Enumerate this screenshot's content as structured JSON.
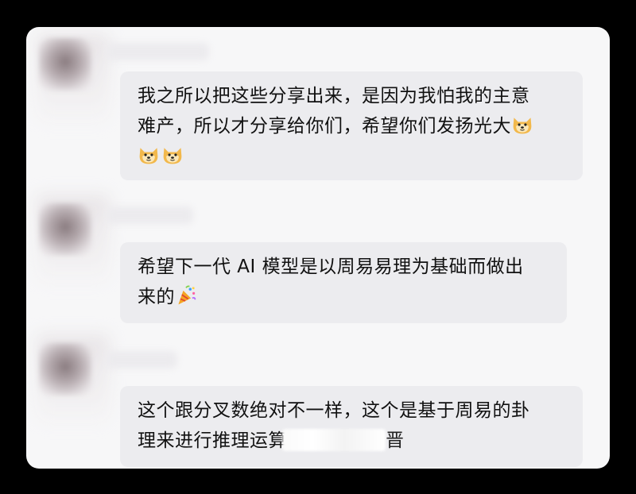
{
  "messages": [
    {
      "lines": [
        "我之所以把这些分享出来，是因为我怕我的主意",
        "难产，所以才分享给你们，希望你们发扬光大"
      ],
      "emojis": [
        "doge-emoji",
        "doge-emoji",
        "doge-emoji"
      ]
    },
    {
      "lines": [
        "希望下一代 AI 模型是以周易易理为基础而做出",
        "来的"
      ],
      "emojis": [
        "party-popper-emoji"
      ]
    },
    {
      "lines": [
        "这个跟分叉数绝对不一样，这个是基于周易的卦",
        "理来进行推理运算",
        "晋"
      ]
    }
  ]
}
